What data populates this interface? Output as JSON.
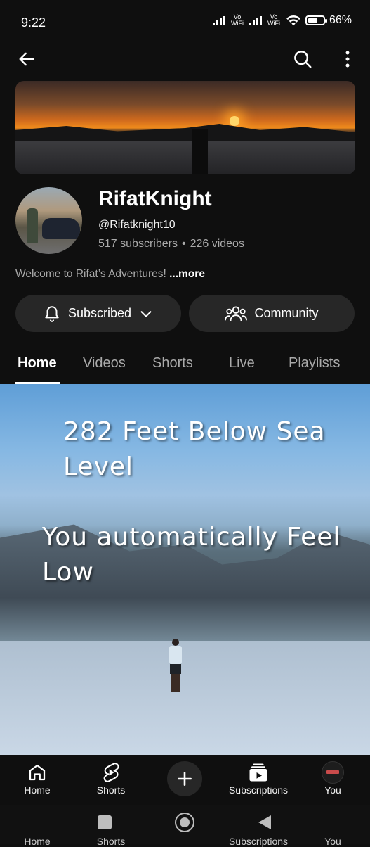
{
  "status_bar": {
    "time": "9:22",
    "sim1_label": "Vo WiFi",
    "sim2_label": "Vo WiFi",
    "battery_percent": "66%",
    "battery_level": 0.66
  },
  "top_bar": {
    "back_icon": "arrow-left-icon",
    "search_icon": "search-icon",
    "more_icon": "more-vert-icon"
  },
  "channel": {
    "name": "RifatKnight",
    "handle": "@Rifatknight10",
    "subscribers": "517 subscribers",
    "separator": "•",
    "videos": "226 videos",
    "description": "Welcome to Rifat’s Adventures!",
    "more_link": "...more"
  },
  "actions": {
    "subscribed_label": "Subscribed",
    "community_label": "Community"
  },
  "tabs": [
    {
      "label": "Home",
      "active": true
    },
    {
      "label": "Videos",
      "active": false
    },
    {
      "label": "Shorts",
      "active": false
    },
    {
      "label": "Live",
      "active": false
    },
    {
      "label": "Playlists",
      "active": false
    }
  ],
  "featured_video": {
    "overlay_line1": "282 Feet Below Sea",
    "overlay_line2": "Level",
    "overlay_line3": "You automatically Feel",
    "overlay_line4": "Low"
  },
  "bottom_nav": [
    {
      "label": "Home",
      "icon": "home-icon"
    },
    {
      "label": "Shorts",
      "icon": "shorts-icon"
    },
    {
      "label": "",
      "icon": "plus-icon"
    },
    {
      "label": "Subscriptions",
      "icon": "subscriptions-icon"
    },
    {
      "label": "You",
      "icon": "avatar"
    }
  ],
  "colors": {
    "background": "#0f0f0f",
    "pill": "#272727",
    "secondary_text": "#aaaaaa"
  }
}
